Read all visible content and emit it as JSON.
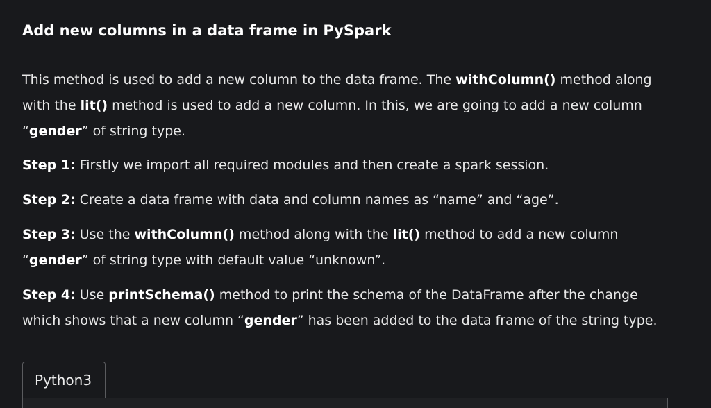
{
  "title": "Add new columns in a data frame in PySpark",
  "intro": {
    "t1": "This method is used to add a new column to the data frame. The ",
    "code1": "withColumn()",
    "t2": " method along with the ",
    "code2": "lit()",
    "t3": " method is used to add a new column. In this, we are going to add a new column “",
    "bold1": "gender",
    "t4": "” of string type."
  },
  "steps": [
    {
      "label": "Step 1:",
      "t1": " Firstly we import all required modules and then create a spark session."
    },
    {
      "label": "Step 2:",
      "t1": " Create a data frame with data and column names as “name” and “age”."
    },
    {
      "label": "Step 3:",
      "t1": " Use the ",
      "code1": "withColumn()",
      "t2": " method along with the ",
      "code2": "lit()",
      "t3": " method to add a new column “",
      "bold1": "gender",
      "t4": "” of string type with default value “unknown”."
    },
    {
      "label": "Step 4:",
      "t1": " Use ",
      "code1": "printSchema()",
      "t2": " method to print the schema of the DataFrame after the change which shows that a new column “",
      "bold1": "gender",
      "t3": "” has been added to the data frame of the string type."
    }
  ],
  "code_tab": {
    "label": "Python3"
  }
}
